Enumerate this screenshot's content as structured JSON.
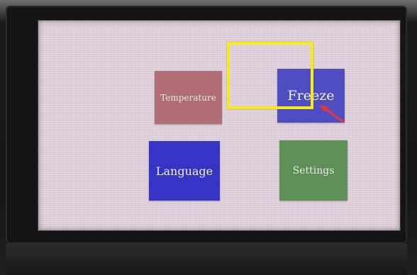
{
  "screen": {
    "buttons": {
      "temperature": "Temperature",
      "freeze": "Freeze",
      "language": "Language",
      "settings": "Settings"
    }
  },
  "overlay": {
    "selected_item": "Freeze",
    "highlight_color": "#f7ec12",
    "arrow_color": "#e53935"
  },
  "colors": {
    "temperature_button": "#b16e74",
    "freeze_button": "#4f4dc2",
    "language_button": "#3634c5",
    "settings_button": "#5f9058",
    "screen_background": "#e6d6e2"
  }
}
